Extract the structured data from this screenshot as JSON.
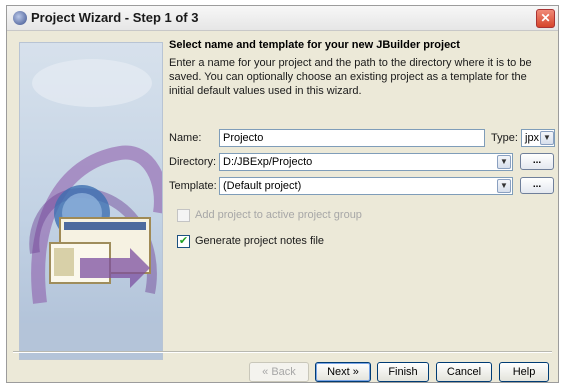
{
  "window": {
    "title": "Project Wizard - Step 1 of 3",
    "close_label": "✕"
  },
  "main": {
    "heading": "Select name and template for your new JBuilder project",
    "description": "Enter a name for your project and the path to the directory where it is to be saved. You can optionally choose an existing project as a template for the initial default values used in this wizard."
  },
  "form": {
    "name_label": "Name:",
    "name_value": "Projecto",
    "type_label": "Type:",
    "type_value": "jpx",
    "directory_label": "Directory:",
    "directory_value": "D:/JBExp/Projecto",
    "template_label": "Template:",
    "template_value": "(Default project)",
    "browse_label": "...",
    "add_to_group_label": "Add project to active project group",
    "add_to_group_checked": false,
    "add_to_group_enabled": false,
    "generate_notes_label": "Generate project notes file",
    "generate_notes_checked": true
  },
  "buttons": {
    "back": "« Back",
    "next": "Next »",
    "finish": "Finish",
    "cancel": "Cancel",
    "help": "Help"
  },
  "icons": {
    "title": "app-logo-icon",
    "dropdown": "chevron-down-icon",
    "check": "checkmark-icon"
  },
  "colors": {
    "dialog_bg": "#ece9d8",
    "close_button": "#d6452b",
    "check_mark": "#21a121"
  }
}
